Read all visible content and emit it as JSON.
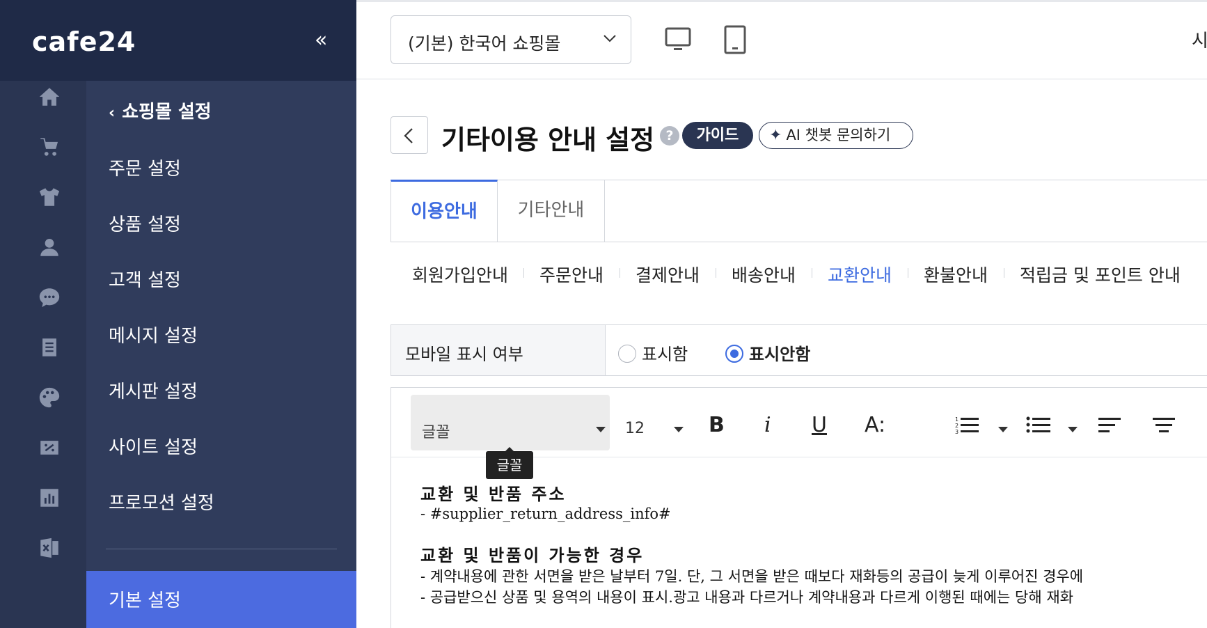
{
  "brand": {
    "logo": "cafe24",
    "collapse_icon": "«"
  },
  "rail": {
    "icons": [
      "home-icon",
      "cart-icon",
      "tshirt-icon",
      "person-icon",
      "chat-icon",
      "board-icon",
      "palette-icon",
      "promotion-icon",
      "chart-icon",
      "excel-icon"
    ]
  },
  "submenu": {
    "back_label": "쇼핑몰 설정",
    "items": [
      "주문 설정",
      "상품 설정",
      "고객 설정",
      "메시지 설정",
      "게시판 설정",
      "사이트 설정",
      "프로모션 설정"
    ],
    "active_item": "기본 설정"
  },
  "topbar": {
    "mall_select": "(기본) 한국어 쇼핑몰",
    "cut_text": "시"
  },
  "page": {
    "title": "기타이용 안내 설정",
    "help": "?",
    "guide_label": "가이드",
    "ai_label": "AI 챗봇 문의하기"
  },
  "tabs": [
    "이용안내",
    "기타안내"
  ],
  "subtabs": [
    "회원가입안내",
    "주문안내",
    "결제안내",
    "배송안내",
    "교환안내",
    "환불안내",
    "적립금 및 포인트 안내"
  ],
  "active_subtab": 4,
  "mobile_display": {
    "label": "모바일 표시 여부",
    "options": [
      "표시함",
      "표시안함"
    ],
    "selected": 1
  },
  "editor": {
    "font_placeholder": "글꼴",
    "font_size": "12",
    "tooltip": "글꼴",
    "bold": "B",
    "italic": "i",
    "underline": "U",
    "text_size": "A:",
    "content": {
      "heading1": "교환 및 반품 주소",
      "line1": " - #supplier_return_address_info#",
      "heading2": "교환 및 반품이 가능한 경우",
      "line2": " - 계약내용에 관한 서면을 받은 날부터 7일. 단, 그 서면을 받은 때보다 재화등의 공급이 늦게 이루어진 경우에",
      "line3": "  - 공급받으신 상품 및 용역의 내용이 표시.광고 내용과 다르거나 계약내용과 다르게 이행된 때에는 당해 재화"
    }
  },
  "colors": {
    "rail": "#2a3552",
    "submenu": "#303c5c",
    "accent": "#3d6be0",
    "active_menu": "#4c6be0"
  }
}
